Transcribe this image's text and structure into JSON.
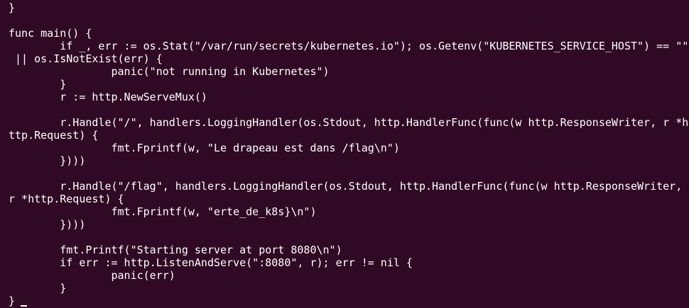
{
  "terminal": {
    "lines": [
      "}",
      "",
      "func main() {",
      "        if _, err := os.Stat(\"/var/run/secrets/kubernetes.io\"); os.Getenv(\"KUBERNETES_SERVICE_HOST\") == \"\"",
      " || os.IsNotExist(err) {",
      "                panic(\"not running in Kubernetes\")",
      "        }",
      "        r := http.NewServeMux()",
      "",
      "        r.Handle(\"/\", handlers.LoggingHandler(os.Stdout, http.HandlerFunc(func(w http.ResponseWriter, r *h",
      "ttp.Request) {",
      "                fmt.Fprintf(w, \"Le drapeau est dans /flag\\n\")",
      "        })))",
      "",
      "        r.Handle(\"/flag\", handlers.LoggingHandler(os.Stdout, http.HandlerFunc(func(w http.ResponseWriter,",
      "r *http.Request) {",
      "                fmt.Fprintf(w, \"erte_de_k8s}\\n\")",
      "        })))",
      "",
      "        fmt.Printf(\"Starting server at port 8080\\n\")",
      "        if err := http.ListenAndServe(\":8080\", r); err != nil {",
      "                panic(err)",
      "        }",
      "}"
    ]
  }
}
